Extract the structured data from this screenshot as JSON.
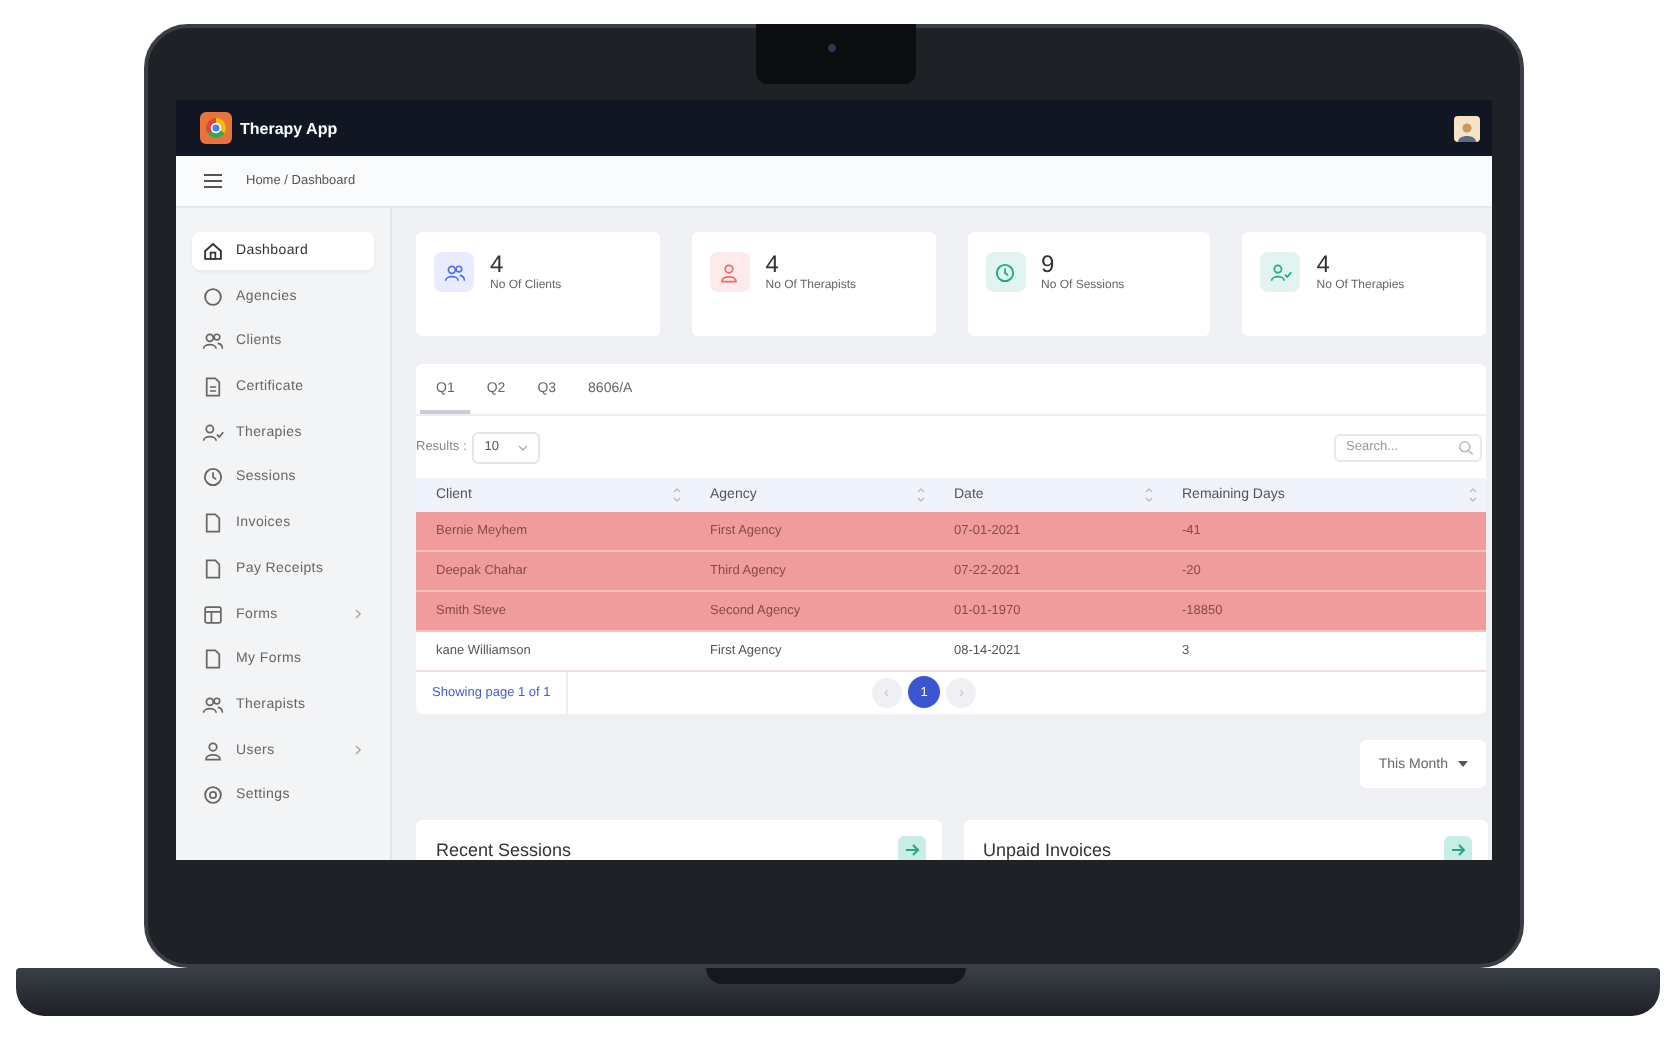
{
  "app": {
    "title": "Therapy App"
  },
  "breadcrumb": "Home / Dashboard",
  "sidebar": {
    "items": [
      {
        "label": "Dashboard",
        "selected": true,
        "expandable": false
      },
      {
        "label": "Agencies",
        "selected": false,
        "expandable": false
      },
      {
        "label": "Clients",
        "selected": false,
        "expandable": false
      },
      {
        "label": "Certificate",
        "selected": false,
        "expandable": false
      },
      {
        "label": "Therapies",
        "selected": false,
        "expandable": false
      },
      {
        "label": "Sessions",
        "selected": false,
        "expandable": false
      },
      {
        "label": "Invoices",
        "selected": false,
        "expandable": false
      },
      {
        "label": "Pay Receipts",
        "selected": false,
        "expandable": false
      },
      {
        "label": "Forms",
        "selected": false,
        "expandable": true
      },
      {
        "label": "My Forms",
        "selected": false,
        "expandable": false
      },
      {
        "label": "Therapists",
        "selected": false,
        "expandable": false
      },
      {
        "label": "Users",
        "selected": false,
        "expandable": true
      },
      {
        "label": "Settings",
        "selected": false,
        "expandable": false
      }
    ]
  },
  "stats": [
    {
      "value": "4",
      "label": "No Of Clients",
      "color": "#4f6ef7"
    },
    {
      "value": "4",
      "label": "No Of Therapists",
      "color": "#f06a6a"
    },
    {
      "value": "9",
      "label": "No Of Sessions",
      "color": "#1fa98a"
    },
    {
      "value": "4",
      "label": "No Of Therapies",
      "color": "#1fa98a"
    }
  ],
  "tabs": [
    {
      "label": "Q1",
      "selected": true
    },
    {
      "label": "Q2",
      "selected": false
    },
    {
      "label": "Q3",
      "selected": false
    },
    {
      "label": "8606/A",
      "selected": false
    }
  ],
  "results": {
    "label": "Results :",
    "value": "10"
  },
  "search": {
    "placeholder": "Search..."
  },
  "table": {
    "columns": [
      "Client",
      "Agency",
      "Date",
      "Remaining Days"
    ],
    "rows": [
      {
        "cells": [
          "Bernie Meyhem",
          "First Agency",
          "07-01-2021",
          "-41"
        ],
        "highlighted": true
      },
      {
        "cells": [
          "Deepak Chahar",
          "Third Agency",
          "07-22-2021",
          "-20"
        ],
        "highlighted": true
      },
      {
        "cells": [
          "Smith Steve",
          "Second Agency",
          "01-01-1970",
          "-18850"
        ],
        "highlighted": true
      },
      {
        "cells": [
          "kane Williamson",
          "First Agency",
          "08-14-2021",
          "3"
        ],
        "highlighted": false
      }
    ]
  },
  "pagination": {
    "info": "Showing page 1 of 1",
    "pages": [
      {
        "label": "1",
        "selected": true
      }
    ]
  },
  "period_button": "This Month",
  "panels": [
    {
      "title": "Recent Sessions"
    },
    {
      "title": "Unpaid Invoices"
    }
  ]
}
